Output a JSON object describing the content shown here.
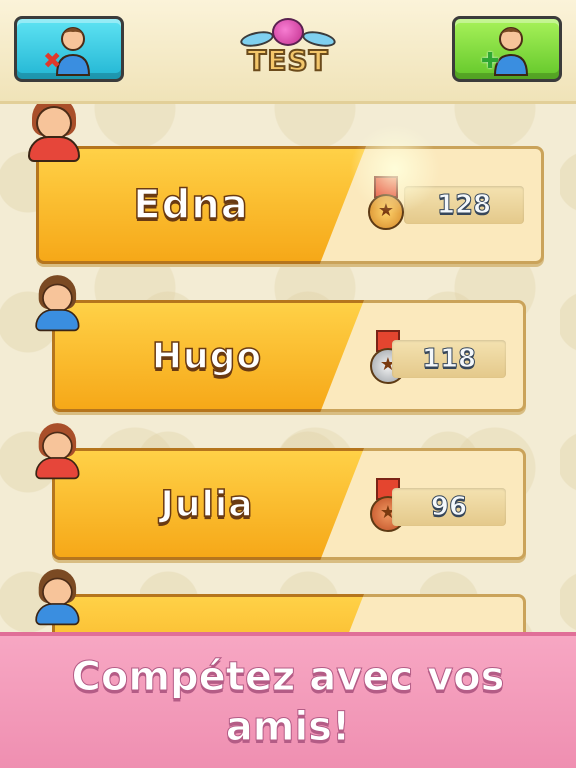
{
  "header": {
    "logo_text": "TEST",
    "remove_friend_icon": "remove-user-icon",
    "add_friend_icon": "add-user-icon"
  },
  "leaderboard": [
    {
      "name": "Edna",
      "score": "128",
      "medal": "gold",
      "avatar": "girl"
    },
    {
      "name": "Hugo",
      "score": "118",
      "medal": "silver",
      "avatar": "boy"
    },
    {
      "name": "Julia",
      "score": "96",
      "medal": "bronze",
      "avatar": "girl"
    },
    {
      "name": "",
      "score": "",
      "medal": "",
      "avatar": "boy"
    }
  ],
  "banner": {
    "text": "Compétez avec vos amis!"
  },
  "colors": {
    "name_panel": "#f6a818",
    "banner": "#ef8fb1",
    "remove_button": "#22b6d4",
    "add_button": "#63c72a"
  }
}
